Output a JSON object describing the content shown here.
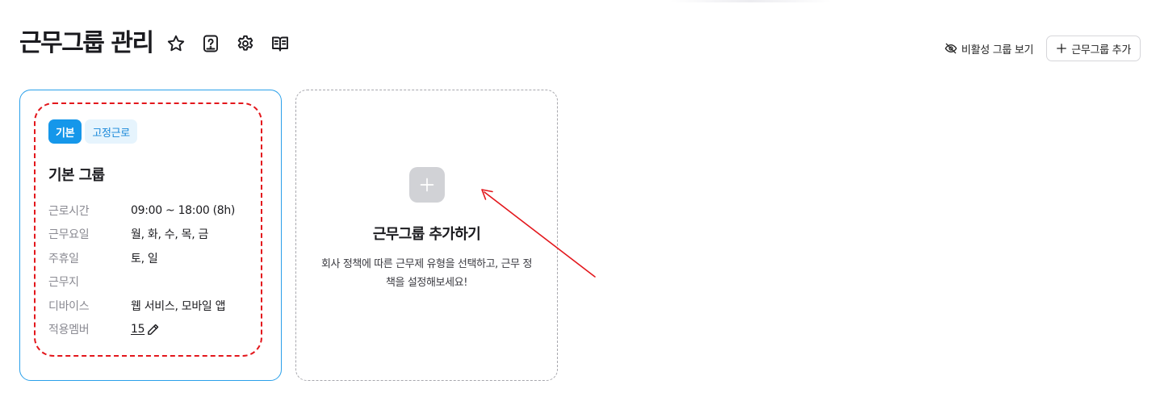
{
  "header": {
    "title": "근무그룹 관리",
    "show_inactive_label": "비활성 그룹 보기",
    "add_group_label": "근무그룹 추가"
  },
  "group_card": {
    "badges": [
      "기본",
      "고정근로"
    ],
    "title": "기본 그룹",
    "rows": [
      {
        "label": "근로시간",
        "value": "09:00 ~ 18:00 (8h)"
      },
      {
        "label": "근무요일",
        "value": "월, 화, 수, 목, 금"
      },
      {
        "label": "주휴일",
        "value": "토, 일"
      },
      {
        "label": "근무지",
        "value": ""
      },
      {
        "label": "디바이스",
        "value": "웹 서비스, 모바일 앱"
      },
      {
        "label": "적용멤버",
        "value": "15"
      }
    ]
  },
  "add_card": {
    "title": "근무그룹 추가하기",
    "description": "회사 정책에 따른 근무제 유형을 선택하고, 근무 정책을 설정해보세요!"
  },
  "colors": {
    "accent": "#1597ea",
    "card_border": "#2aa0ea",
    "annotation": "#e3171c"
  }
}
